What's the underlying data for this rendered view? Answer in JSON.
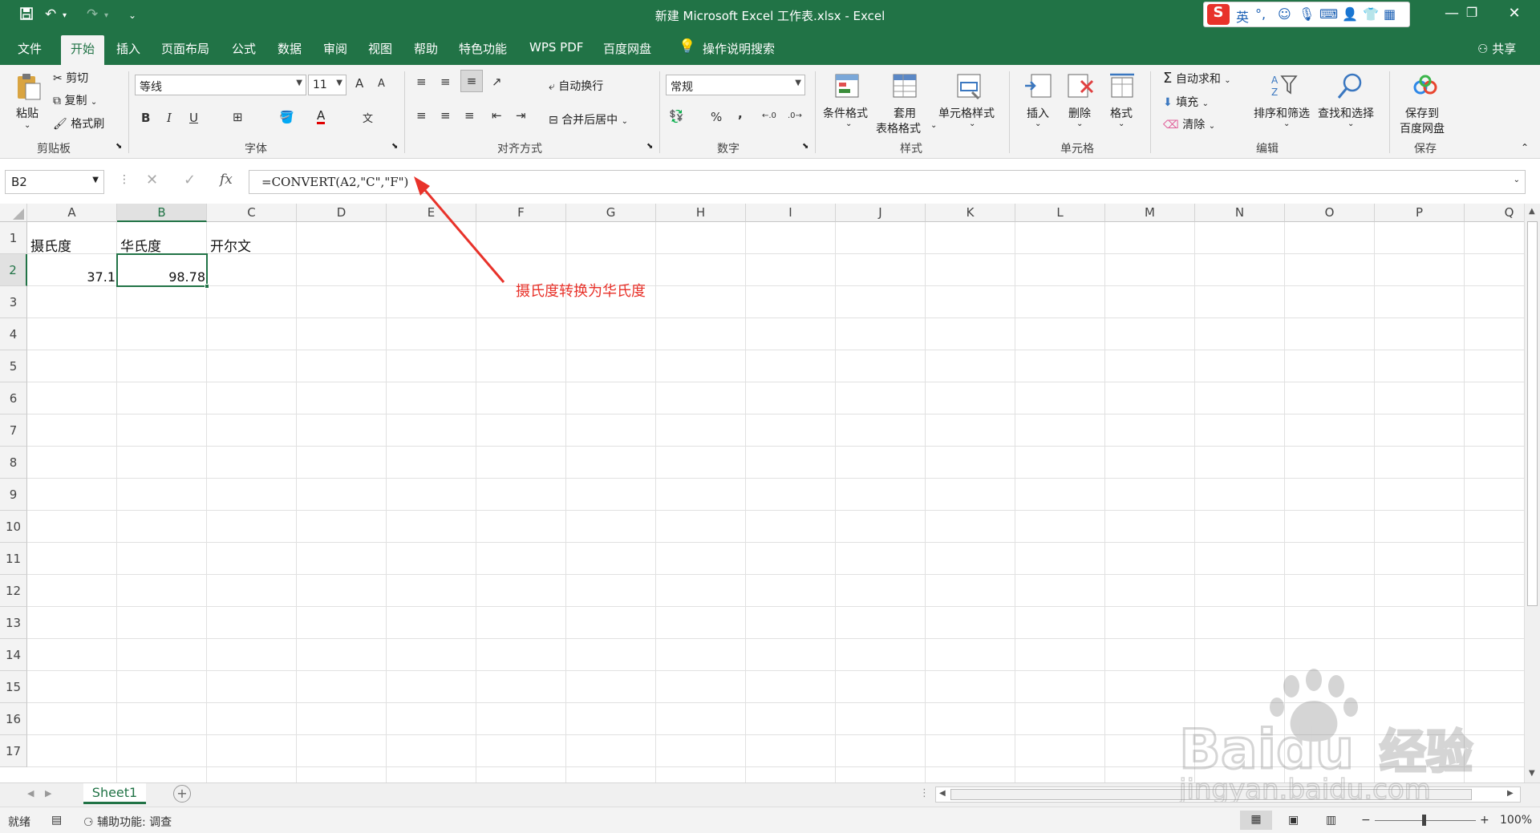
{
  "window": {
    "title": "新建 Microsoft Excel 工作表.xlsx  -  Excel",
    "controls": [
      "—",
      "❐",
      "✕"
    ]
  },
  "ime": {
    "lang": "英",
    "punct": "°,"
  },
  "tabs": [
    {
      "label": "文件"
    },
    {
      "label": "开始"
    },
    {
      "label": "插入"
    },
    {
      "label": "页面布局"
    },
    {
      "label": "公式"
    },
    {
      "label": "数据"
    },
    {
      "label": "审阅"
    },
    {
      "label": "视图"
    },
    {
      "label": "帮助"
    },
    {
      "label": "特色功能"
    },
    {
      "label": "WPS PDF"
    },
    {
      "label": "百度网盘"
    }
  ],
  "tell_me": "操作说明搜索",
  "share": "共享",
  "ribbon": {
    "clipboard": {
      "paste": "粘贴",
      "cut": "剪切",
      "copy": "复制",
      "format_painter": "格式刷",
      "label": "剪贴板"
    },
    "font": {
      "name": "等线",
      "size": "11",
      "bold": "B",
      "italic": "I",
      "underline": "U",
      "grow": "A",
      "shrink": "A",
      "color_letter": "A",
      "phonetic": "文",
      "label": "字体"
    },
    "alignment": {
      "wrap": "自动换行",
      "merge": "合并后居中",
      "label": "对齐方式"
    },
    "number": {
      "format": "常规",
      "percent": "%",
      "comma": ",",
      "label": "数字"
    },
    "styles": {
      "conditional": "条件格式",
      "table1": "套用",
      "table2": "表格格式",
      "cell_styles": "单元格样式",
      "label": "样式"
    },
    "cells": {
      "insert": "插入",
      "delete": "删除",
      "format": "格式",
      "label": "单元格"
    },
    "editing": {
      "autosum": "自动求和",
      "fill": "填充",
      "clear": "清除",
      "sort": "排序和筛选",
      "find": "查找和选择",
      "label": "编辑"
    },
    "save": {
      "line1": "保存到",
      "line2": "百度网盘",
      "label": "保存"
    }
  },
  "formula_bar": {
    "name_box": "B2",
    "formula": "=CONVERT(A2,\"C\",\"F\")",
    "fx": "fx"
  },
  "columns": [
    "A",
    "B",
    "C",
    "D",
    "E",
    "F",
    "G",
    "H",
    "I",
    "J",
    "K",
    "L",
    "M",
    "N",
    "O",
    "P",
    "Q"
  ],
  "rows": [
    "1",
    "2",
    "3",
    "4",
    "5",
    "6",
    "7",
    "8",
    "9",
    "10",
    "11",
    "12",
    "13",
    "14",
    "15",
    "16",
    "17"
  ],
  "cells": {
    "A1": "摄氏度",
    "B1": "华氏度",
    "C1": "开尔文",
    "A2": "37.1",
    "B2": "98.78"
  },
  "annotation": "摄氏度转换为华氏度",
  "sheet_tabs": [
    "Sheet1"
  ],
  "status": {
    "ready": "就绪",
    "accessibility": "辅助功能: 调查",
    "zoom": "100%",
    "minus": "−",
    "plus": "+"
  },
  "watermark": {
    "brand": "Baidu",
    "cn": "经验",
    "url": "jingyan.baidu.com"
  },
  "colors": {
    "excel_green": "#217346",
    "annotation_red": "#e8322a"
  }
}
